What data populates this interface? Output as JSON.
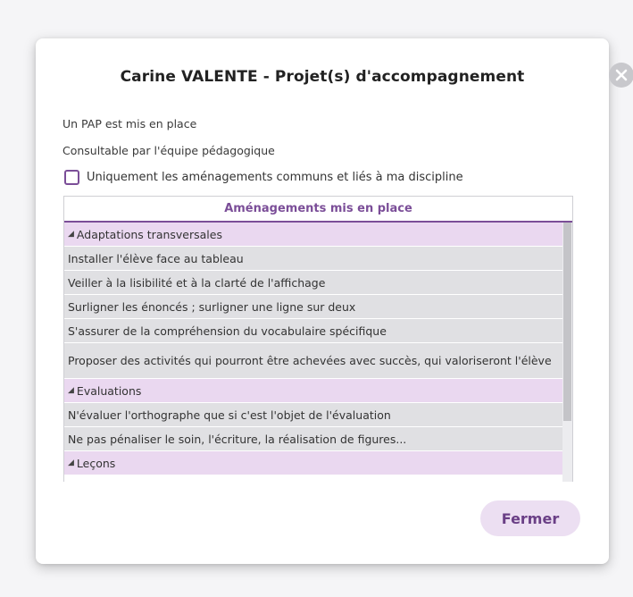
{
  "dialog": {
    "title": "Carine VALENTE - Projet(s) d'accompagnement",
    "info_line_1": "Un PAP est mis en place",
    "info_line_2": "Consultable par l'équipe pédagogique",
    "filter_label": "Uniquement les aménagements communs et liés à ma discipline",
    "filter_checked": false,
    "close_icon": "close-icon",
    "close_button_label": "Fermer",
    "accent_color": "#7b4e98"
  },
  "table": {
    "header": "Aménagements mis en place",
    "rows": [
      {
        "type": "group",
        "label": "Adaptations transversales"
      },
      {
        "type": "item",
        "label": "Installer l'élève face au tableau"
      },
      {
        "type": "item",
        "label": "Veiller à la lisibilité et à la clarté de l'affichage"
      },
      {
        "type": "item",
        "label": "Surligner les énoncés ; surligner une ligne sur deux"
      },
      {
        "type": "item",
        "label": "S'assurer de la compréhension du vocabulaire spécifique"
      },
      {
        "type": "item",
        "label": "Proposer des activités qui pourront être achevées avec succès, qui valoriseront l'élève"
      },
      {
        "type": "group",
        "label": "Evaluations"
      },
      {
        "type": "item",
        "label": "N'évaluer l'orthographe que si c'est l'objet de l'évaluation"
      },
      {
        "type": "item",
        "label": "Ne pas pénaliser le soin, l'écriture, la réalisation de figures..."
      },
      {
        "type": "group",
        "label": "Leçons"
      }
    ]
  }
}
